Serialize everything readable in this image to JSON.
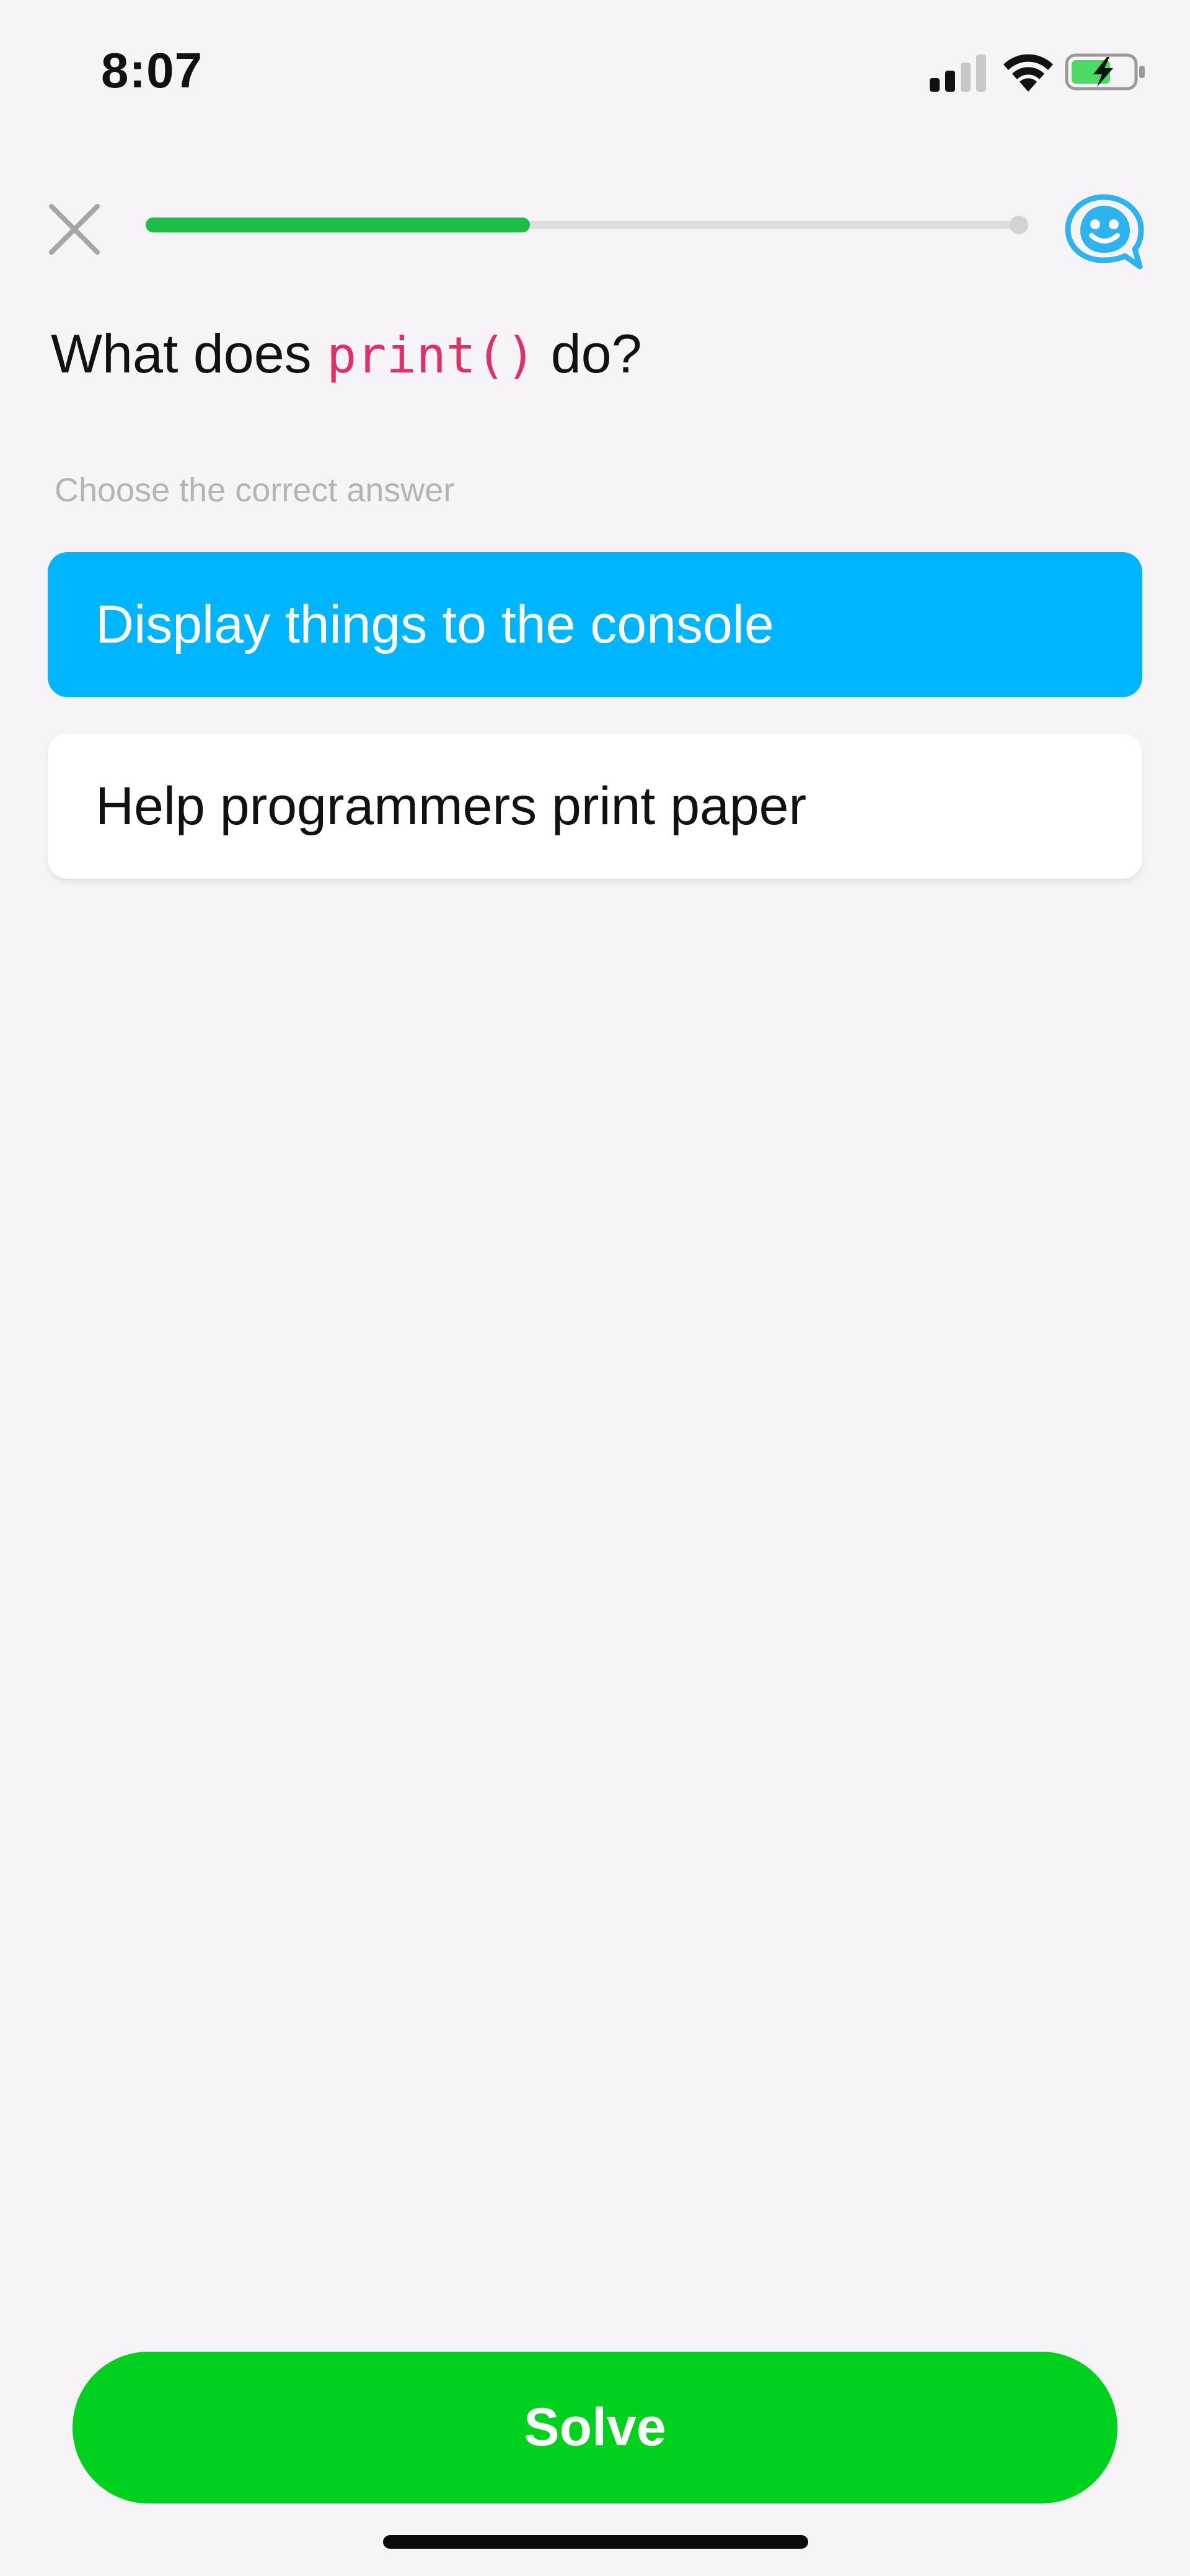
{
  "status_bar": {
    "time": "8:07",
    "icons": [
      "signal-icon",
      "wifi-icon",
      "battery-charging-icon"
    ]
  },
  "header": {
    "close_icon": "close-icon",
    "progress_fraction": 0.44,
    "help_icon": "smiley-chat-icon"
  },
  "question": {
    "prefix": "What does ",
    "code": "print()",
    "suffix": " do?"
  },
  "instruction": "Choose the correct answer",
  "options": [
    {
      "label": "Display things to the console",
      "selected": true
    },
    {
      "label": "Help programmers print paper",
      "selected": false
    }
  ],
  "solve_button": {
    "label": "Solve"
  },
  "colors": {
    "background": "#F6F4F6",
    "selected_option": "#00B5FF",
    "progress": "#1DBE47",
    "solve": "#00D11E",
    "code": "#E0306A",
    "help_icon": "#2DB4F0"
  }
}
